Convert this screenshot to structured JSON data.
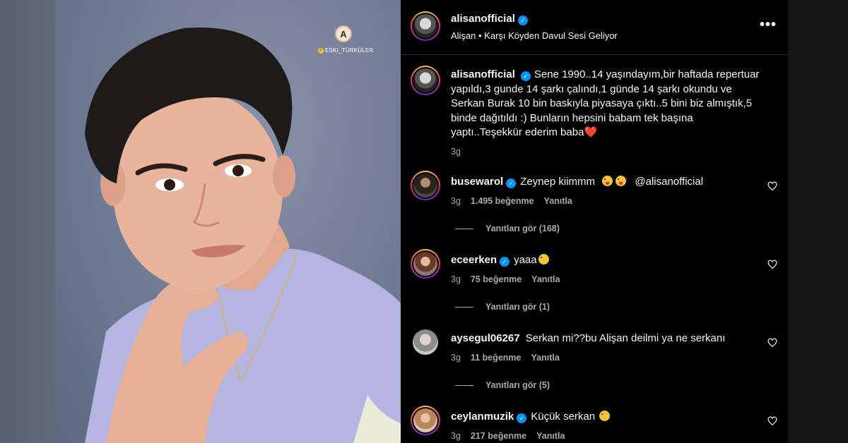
{
  "watermark": {
    "logo_glyph": "A",
    "handle": "ESKI_TÜRKÜLER"
  },
  "header": {
    "username": "alisanofficial",
    "subtitle": "Alişan • Karşı Köyden Davul Sesi Geliyor",
    "more_label": "•••"
  },
  "caption": {
    "username": "alisanofficial",
    "text": "Sene 1990..14 yaşındayım,bir haftada repertuar yapıldı,3 gunde 14 şarkı çalındı,1 günde 14 şarkı okundu ve Serkan Burak 10 bin baskıyla piyasaya çıktı..5 bini biz almıştık,5 binde dağıtıldı :) Bunların hepsini babam tek başına yaptı..Teşekkür ederim baba",
    "heart_emoji": "❤️",
    "time": "3g"
  },
  "comments": [
    {
      "username": "busewarol",
      "verified": true,
      "text_before": "Zeynep kiimmm",
      "emojis": 2,
      "mention": "@alisanofficial",
      "time": "3g",
      "likes": "1.495 beğenme",
      "reply": "Yanıtla",
      "view_replies": "Yanıtları gör (168)"
    },
    {
      "username": "eceerken",
      "verified": true,
      "text_before": "yaaa",
      "emojis": 1,
      "mention": "",
      "time": "3g",
      "likes": "75 beğenme",
      "reply": "Yanıtla",
      "view_replies": "Yanıtları gör (1)"
    },
    {
      "username": "aysegul06267",
      "verified": false,
      "text_before": "Serkan mi??bu Alişan deilmi ya ne serkanı",
      "emojis": 0,
      "mention": "",
      "time": "3g",
      "likes": "11 beğenme",
      "reply": "Yanıtla",
      "view_replies": "Yanıtları gör (5)"
    },
    {
      "username": "ceylanmuzik",
      "verified": true,
      "text_before": "Küçük serkan",
      "emojis": 1,
      "mention": "",
      "time": "3g",
      "likes": "217 beğenme",
      "reply": "Yanıtla",
      "view_replies": ""
    }
  ],
  "colors": {
    "verified": "#0095f6",
    "muted": "#a8a8a8",
    "background": "#000000",
    "heart": "#e0245e"
  },
  "icons": {
    "verified": "verified-badge-icon",
    "like": "heart-outline-icon",
    "more": "more-options-icon"
  }
}
